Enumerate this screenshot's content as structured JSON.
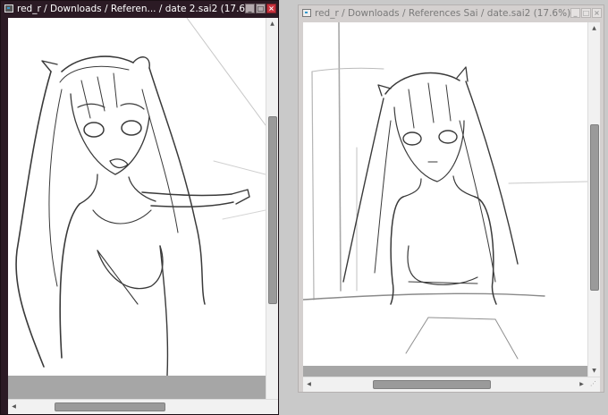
{
  "windows": {
    "left": {
      "title": "red_r / Downloads / Referen... / date 2.sai2 (17.6%)",
      "minimize": "_",
      "maximize": "□",
      "close": "×"
    },
    "right": {
      "title": "red_r / Downloads / References Sai / date.sai2 (17.6%)",
      "minimize": "_",
      "maximize": "□",
      "close": "×"
    }
  },
  "icons": {
    "app": "sai-app-icon",
    "arrow_up": "▲",
    "arrow_down": "▼",
    "arrow_left": "◀",
    "arrow_right": "▶",
    "grip": "⋰"
  },
  "colors": {
    "active_title_bg": "#2b1a24",
    "inactive_title_bg": "#d4d0cf",
    "close_red": "#c9323e",
    "canvas": "#ffffff",
    "outside_canvas": "#a6a6a6"
  },
  "scroll": {
    "left_vertical_position": 0.45,
    "right_vertical_position": 0.5,
    "right_horizontal_position": 0.45
  }
}
